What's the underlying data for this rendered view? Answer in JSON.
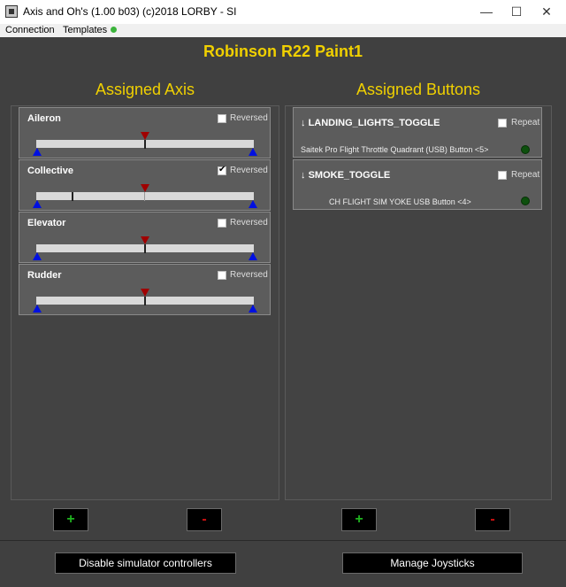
{
  "window": {
    "title": "Axis and Oh's (1.00 b03) (c)2018 LORBY - SI",
    "minimize": "—",
    "maximize": "☐",
    "close": "✕"
  },
  "menu": {
    "items": [
      "Connection",
      "Templates"
    ],
    "status_color": "#3cb43c"
  },
  "profile_title": "Robinson R22 Paint1",
  "axis_section": {
    "title": "Assigned Axis",
    "reversed_label": "Reversed",
    "axes": [
      {
        "name": "Aileron",
        "reversed": false,
        "position": 0.5,
        "marker": 0.5
      },
      {
        "name": "Collective",
        "reversed": true,
        "position": 0.16,
        "marker": 0.5
      },
      {
        "name": "Elevator",
        "reversed": false,
        "position": 0.5,
        "marker": 0.5
      },
      {
        "name": "Rudder",
        "reversed": false,
        "position": 0.5,
        "marker": 0.5
      }
    ],
    "add_label": "+",
    "remove_label": "-"
  },
  "buttons_section": {
    "title": "Assigned Buttons",
    "repeat_label": "Repeat",
    "buttons": [
      {
        "arrow": "↓",
        "name": "LANDING_LIGHTS_TOGGLE",
        "repeat": false,
        "device": "Saitek Pro Flight Throttle Quadrant (USB) Button <5>"
      },
      {
        "arrow": "↓",
        "name": "SMOKE_TOGGLE",
        "repeat": false,
        "device": "CH FLIGHT SIM YOKE USB  Button <4>"
      }
    ],
    "add_label": "+",
    "remove_label": "-"
  },
  "footer": {
    "disable_label": "Disable simulator controllers",
    "manage_label": "Manage Joysticks"
  },
  "colors": {
    "accent_yellow": "#f0d000",
    "add_green": "#1fb21f",
    "remove_red": "#d11111"
  }
}
